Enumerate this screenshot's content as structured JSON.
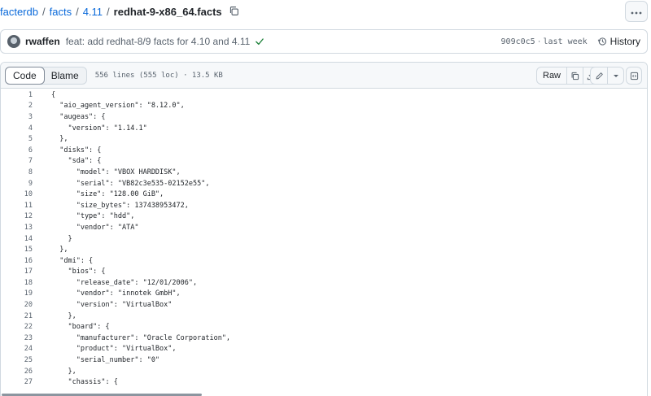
{
  "breadcrumb": {
    "repo": "facterdb",
    "dir1": "facts",
    "dir2": "4.11",
    "file": "redhat-9-x86_64.facts",
    "separator": "/"
  },
  "commit": {
    "author": "rwaffen",
    "message": "feat: add redhat-8/9 facts for 4.10 and 4.11",
    "sha": "909c0c5",
    "time_sep": " · ",
    "time": "last week",
    "history_label": "History",
    "status_color": "#1a7f37"
  },
  "file_header": {
    "tab_code": "Code",
    "tab_blame": "Blame",
    "info": "556 lines (555 loc) · 13.5 KB",
    "raw_label": "Raw"
  },
  "icons": [
    "copy-icon",
    "kebab-icon",
    "check-icon",
    "history-icon",
    "download-icon",
    "pencil-icon",
    "chevron-down-icon",
    "symbols-icon"
  ],
  "code": {
    "lines": [
      {
        "n": "1",
        "text": "{"
      },
      {
        "n": "2",
        "text": "  \"aio_agent_version\": \"8.12.0\","
      },
      {
        "n": "3",
        "text": "  \"augeas\": {"
      },
      {
        "n": "4",
        "text": "    \"version\": \"1.14.1\""
      },
      {
        "n": "5",
        "text": "  },"
      },
      {
        "n": "6",
        "text": "  \"disks\": {"
      },
      {
        "n": "7",
        "text": "    \"sda\": {"
      },
      {
        "n": "8",
        "text": "      \"model\": \"VBOX HARDDISK\","
      },
      {
        "n": "9",
        "text": "      \"serial\": \"VB82c3e535-02152e55\","
      },
      {
        "n": "10",
        "text": "      \"size\": \"128.00 GiB\","
      },
      {
        "n": "11",
        "text": "      \"size_bytes\": 137438953472,"
      },
      {
        "n": "12",
        "text": "      \"type\": \"hdd\","
      },
      {
        "n": "13",
        "text": "      \"vendor\": \"ATA\""
      },
      {
        "n": "14",
        "text": "    }"
      },
      {
        "n": "15",
        "text": "  },"
      },
      {
        "n": "16",
        "text": "  \"dmi\": {"
      },
      {
        "n": "17",
        "text": "    \"bios\": {"
      },
      {
        "n": "18",
        "text": "      \"release_date\": \"12/01/2006\","
      },
      {
        "n": "19",
        "text": "      \"vendor\": \"innotek GmbH\","
      },
      {
        "n": "20",
        "text": "      \"version\": \"VirtualBox\""
      },
      {
        "n": "21",
        "text": "    },"
      },
      {
        "n": "22",
        "text": "    \"board\": {"
      },
      {
        "n": "23",
        "text": "      \"manufacturer\": \"Oracle Corporation\","
      },
      {
        "n": "24",
        "text": "      \"product\": \"VirtualBox\","
      },
      {
        "n": "25",
        "text": "      \"serial_number\": \"0\""
      },
      {
        "n": "26",
        "text": "    },"
      },
      {
        "n": "27",
        "text": "    \"chassis\": {"
      }
    ]
  }
}
